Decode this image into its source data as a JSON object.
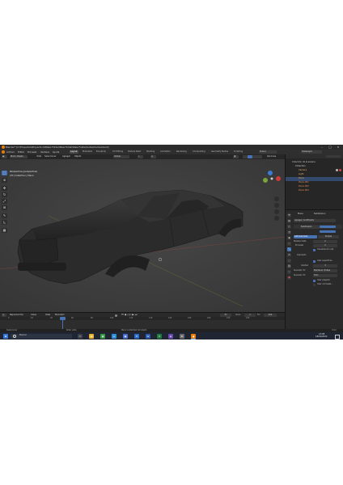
{
  "window": {
    "title": "Blender* [C:\\Proyectos\\Proyecto-19\\New Folder\\New Folder\\New Folder\\Autos\\Coche.blend]"
  },
  "menu": {
    "items": [
      "Archivo",
      "Editar",
      "Procesar",
      "Ventana",
      "Ayuda"
    ]
  },
  "workspaces": {
    "items": [
      "Layout",
      "Modelado",
      "Esculpido",
      "UV Editing",
      "Texture Paint",
      "Shading",
      "Animation",
      "Rendering",
      "Compositing",
      "Geometry Nodes",
      "Scripting"
    ],
    "active": "Layout"
  },
  "scene": {
    "name": "Scene",
    "view_layer": "ViewLayer"
  },
  "header": {
    "mode": "Modo Objeto",
    "view": "Vista",
    "select": "Seleccionar",
    "add": "Agregar",
    "object": "Objeto",
    "orientation": "Global",
    "options": "Opciones"
  },
  "viewport": {
    "perspective": "Perspectiva (perspectiva)",
    "collection": "(37) Collection | Plano"
  },
  "outliner": {
    "title": "Colección de la escena",
    "items": [
      {
        "label": "Collection",
        "color": "#d8d8d8"
      },
      {
        "label": "Camera",
        "color": "#f0b060"
      },
      {
        "label": "Light",
        "color": "#f0b060"
      },
      {
        "label": "Plano",
        "color": "#f0a040"
      },
      {
        "label": "Plano.001",
        "color": "#e88c50"
      },
      {
        "label": "Plano.002",
        "color": "#e88c50"
      },
      {
        "label": "Plano.003",
        "color": "#e88c50"
      }
    ]
  },
  "properties": {
    "object": "Plano",
    "modifier_tab": "Subdivision",
    "add_modifier": "Agregar modificador",
    "modifier_name": "Subdivision",
    "type_catmull": "Catmull-Clark",
    "type_simple": "Simple",
    "levels_viewport_label": "Niveles Vista",
    "levels_viewport": "2",
    "render_label": "Procesar",
    "render": "2",
    "optimal_display": "Visualización ópt.",
    "advanced": "Avanzado",
    "smooth_uv": "Usar superficie...",
    "quality_label": "Calidad",
    "quality": "3",
    "boundary_label": "Suavizar UV",
    "boundary": "Mantener límites",
    "uv_label": "Suavizar UV",
    "uv": "Todo",
    "use_limit": "Usar plegado",
    "use_custom_normals": "Usar normales..."
  },
  "timeline": {
    "playback": "Reproducción",
    "keying": "Clave",
    "view": "Vista",
    "marker": "Marcador",
    "current_frame": "37",
    "start_label": "Inicio",
    "start": "1",
    "end_label": "Fin",
    "end": "250",
    "ticks": [
      "0",
      "20",
      "40",
      "60",
      "80",
      "100",
      "120",
      "140",
      "160",
      "180",
      "200",
      "220",
      "240"
    ]
  },
  "status": {
    "left": "Seleccionar",
    "middle": "Rotar vista",
    "right": "Menú contextual del objeto",
    "version": "3.6.2"
  },
  "taskbar": {
    "search": "Buscar",
    "time": "13:08",
    "date": "18/01/2024",
    "icons": [
      {
        "name": "windows-start-icon",
        "color": "#3a78d8"
      },
      {
        "name": "task-view-icon",
        "color": "#3a3f4a"
      },
      {
        "name": "file-explorer-icon",
        "color": "#e8b030"
      },
      {
        "name": "chrome-icon",
        "color": "#3a9a4a"
      },
      {
        "name": "edge-icon",
        "color": "#2f8fd0"
      },
      {
        "name": "store-icon",
        "color": "#4a6ad0"
      },
      {
        "name": "mail-icon",
        "color": "#2a6ac8"
      },
      {
        "name": "word-icon",
        "color": "#2b5aae"
      },
      {
        "name": "excel-icon",
        "color": "#1f7a3c"
      },
      {
        "name": "photos-icon",
        "color": "#6a4ab0"
      },
      {
        "name": "settings-icon",
        "color": "#6a6a6a"
      },
      {
        "name": "blender-icon",
        "color": "#e87d0d"
      }
    ]
  },
  "colors": {
    "accent": "#4772b3",
    "active_orange": "#e87d0d"
  }
}
